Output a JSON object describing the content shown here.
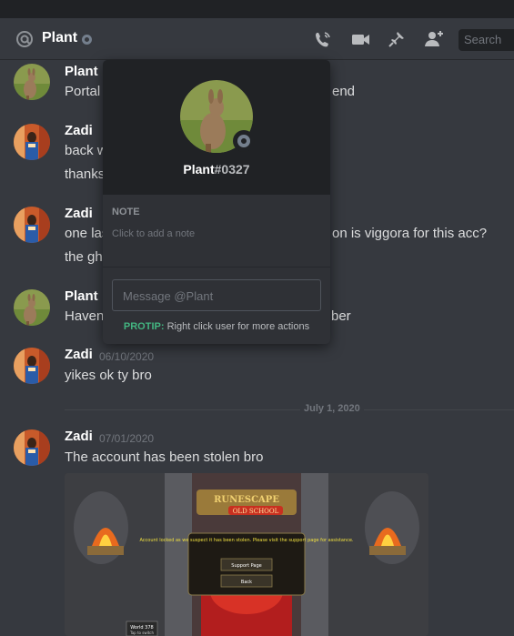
{
  "header": {
    "channel_name": "Plant",
    "search_placeholder": "Search",
    "icons": [
      "at-icon",
      "call-icon",
      "video-icon",
      "pin-icon",
      "add-friend-icon"
    ]
  },
  "messages": [
    {
      "author": "Plant",
      "timestamp": "",
      "lines": [
        "Portal",
        "end"
      ]
    },
    {
      "author": "Zadi",
      "timestamp": "",
      "lines": [
        "back w",
        "thanks"
      ]
    },
    {
      "author": "Zadi",
      "timestamp": "",
      "lines": [
        "one las",
        "on is viggora for this acc?",
        "the gh"
      ]
    },
    {
      "author": "Plant",
      "timestamp": "",
      "lines": [
        "Haven",
        "ber"
      ]
    },
    {
      "author": "Zadi",
      "timestamp": "06/10/2020",
      "lines": [
        "yikes ok ty bro"
      ]
    },
    {
      "author": "Zadi",
      "timestamp": "07/01/2020",
      "lines": [
        "The account has been stolen bro"
      ]
    }
  ],
  "date_divider": "July 1, 2020",
  "attachment": {
    "dialog_text": "Account locked as we suspect it has been stolen. Please visit the support page for assistance.",
    "support_button": "Support Page",
    "back_button": "Back",
    "world_label": "World 378",
    "world_sub": "Tap to switch"
  },
  "popout": {
    "username": "Plant",
    "discriminator": "#0327",
    "note_label": "NOTE",
    "note_placeholder": "Click to add a note",
    "message_placeholder": "Message @Plant",
    "protip_label": "PROTIP:",
    "protip_text": "Right click user for more actions"
  },
  "colors": {
    "background": "#36393f",
    "popout_bg": "#2f3136",
    "popout_head": "#202225",
    "protip_green": "#43b581",
    "status_gray": "#747f8d"
  }
}
